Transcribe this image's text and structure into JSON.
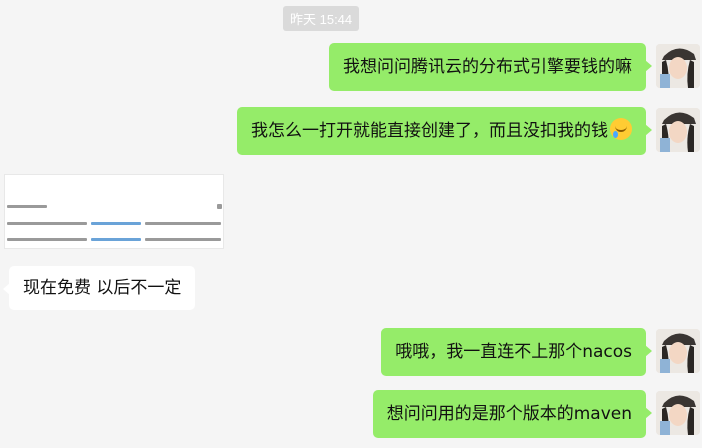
{
  "chat": {
    "timestamp": "昨天 15:44",
    "messages": [
      {
        "side": "out",
        "text": "我想问问腾讯云的分布式引擎要钱的嘛"
      },
      {
        "side": "out",
        "text": "我怎么一打开就能直接创建了，而且没扣我的钱",
        "emoji": "crying-laughing-emoji"
      },
      {
        "side": "in",
        "type": "image"
      },
      {
        "side": "in",
        "text": "现在免费 以后不一定"
      },
      {
        "side": "out",
        "text": "哦哦，我一直连不上那个nacos"
      },
      {
        "side": "out",
        "text": "想问问用的是那个版本的maven"
      }
    ]
  },
  "colors": {
    "background": "#f5f5f5",
    "outgoing_bubble": "#95ec69",
    "incoming_bubble": "#ffffff",
    "timestamp_bg": "#dadada"
  }
}
